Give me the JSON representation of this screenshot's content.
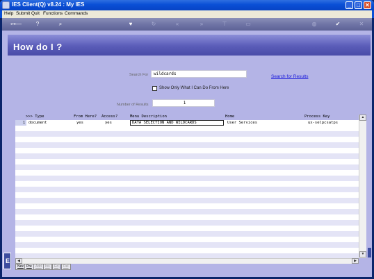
{
  "window": {
    "title": "IES Client(Q) v8.24 : My IES",
    "buttons": {
      "minimize": "_",
      "maximize": "□",
      "close": "✕"
    }
  },
  "menu": [
    "Help",
    "Submit",
    "Quit",
    "Functions",
    "Commands"
  ],
  "toolbar": {
    "icons": [
      "key-icon",
      "help-icon",
      "search-icon",
      "favorite-icon",
      "refresh-icon",
      "back-icon",
      "forward-icon",
      "bookmark-icon",
      "page-icon",
      "globe-icon",
      "check-icon",
      "close-icon"
    ]
  },
  "page": {
    "title": "How do I ?",
    "search_label": "Search For",
    "search_value": "wildcards",
    "search_link": "Search for Results",
    "checkbox_label": "Show Only What I Can Do From Here",
    "checkbox_checked": false,
    "results_label": "Number of Results",
    "results_value": "1"
  },
  "grid": {
    "columns": [
      ">>> Type",
      "From Here?",
      "Access?",
      "Menu Description",
      "Home",
      "Process Key"
    ],
    "rows": [
      {
        "num": "1",
        "type": "document",
        "from_here": "yes",
        "access": "yes",
        "description": "DATA SELECTION AND WILDCARDS",
        "home": "User Services",
        "process_key": "ux-selpcsatps"
      }
    ]
  },
  "bottom_tabs": [
    {
      "label": "Nex",
      "enabled": true
    },
    {
      "label": "Pre",
      "enabled": true
    },
    {
      "label": "Add",
      "enabled": false
    },
    {
      "label": "Ins",
      "enabled": false
    },
    {
      "label": "Ed",
      "enabled": false
    },
    {
      "label": "Del",
      "enabled": false
    }
  ],
  "left_strip_letter": "E"
}
